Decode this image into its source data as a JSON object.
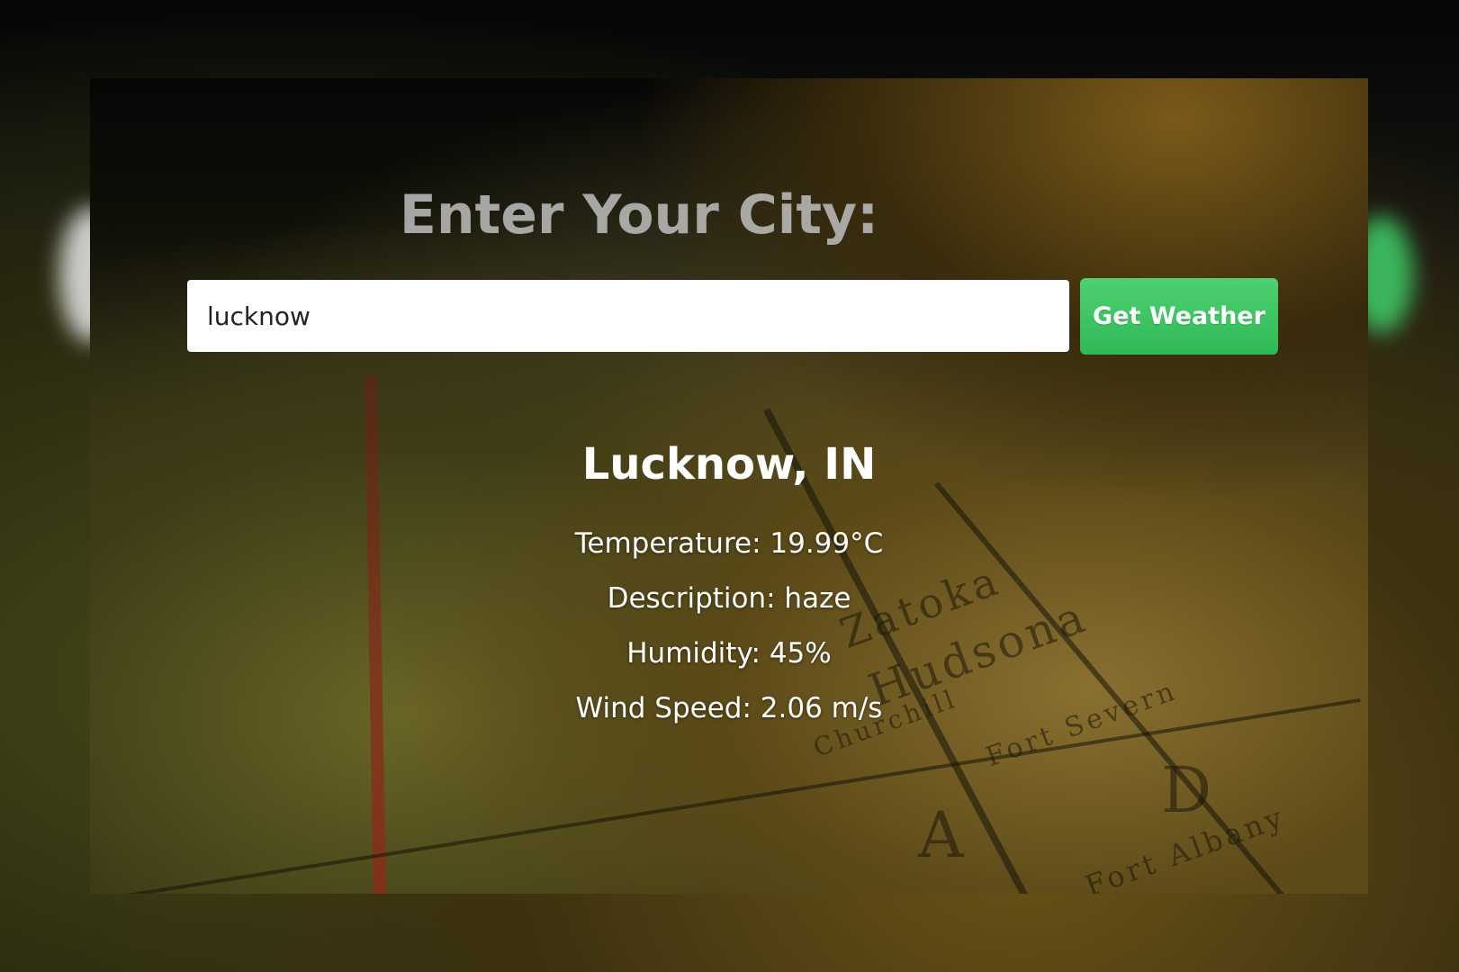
{
  "app": {
    "heading": "Enter Your City:"
  },
  "search": {
    "value": "lucknow",
    "button_label": "Get Weather"
  },
  "weather": {
    "city": "Lucknow, IN",
    "temperature": "Temperature: 19.99°C",
    "description": "Description: haze",
    "humidity": "Humidity: 45%",
    "wind_speed": "Wind Speed: 2.06 m/s"
  },
  "background_map_labels": [
    "Zatoka",
    "Hudsona",
    "Fort Severn",
    "Churchill",
    "Fort Albany",
    "A",
    "D"
  ],
  "colors": {
    "button": "#3cc45f",
    "heading": "#bebebe",
    "result_text": "#ffffff",
    "input_bg": "#ffffff"
  }
}
